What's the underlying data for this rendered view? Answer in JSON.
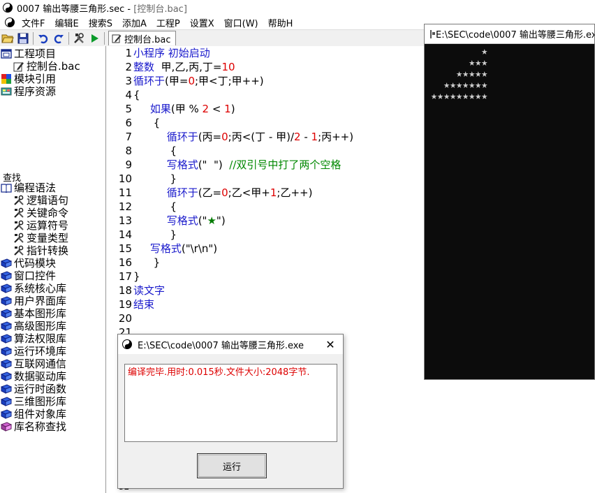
{
  "window": {
    "title_file": "0007 输出等腰三角形.sec",
    "title_sep": " - ",
    "title_doc": "[控制台.bac]"
  },
  "menu": [
    "文件F",
    "编辑E",
    "搜索S",
    "添加A",
    "工程P",
    "设置X",
    "窗口(W)",
    "帮助H"
  ],
  "toolbar": {
    "doc_tab": "控制台.bac"
  },
  "project_tree": [
    {
      "label": "工程项目",
      "icon": "project-window-icon",
      "level": 0
    },
    {
      "label": "控制台.bac",
      "icon": "edit-pencil-icon",
      "level": 1
    },
    {
      "label": "模块引用",
      "icon": "module-ref-icon",
      "level": 0
    },
    {
      "label": "程序资源",
      "icon": "resource-icon",
      "level": 0
    }
  ],
  "find": {
    "title": "查找",
    "items": [
      {
        "label": "编程语法",
        "icon": "open-book-icon",
        "level": 0
      },
      {
        "label": "逻辑语句",
        "icon": "tools-icon",
        "level": 1
      },
      {
        "label": "关键命令",
        "icon": "tools-icon",
        "level": 1
      },
      {
        "label": "运算符号",
        "icon": "tools-icon",
        "level": 1
      },
      {
        "label": "变量类型",
        "icon": "tools-icon",
        "level": 1
      },
      {
        "label": "指针转换",
        "icon": "tools-icon",
        "level": 1
      },
      {
        "label": "代码模块",
        "icon": "blue-book-icon",
        "level": 0
      },
      {
        "label": "窗口控件",
        "icon": "blue-book-icon",
        "level": 0
      },
      {
        "label": "系统核心库",
        "icon": "blue-book-icon",
        "level": 0
      },
      {
        "label": "用户界面库",
        "icon": "blue-book-icon",
        "level": 0
      },
      {
        "label": "基本图形库",
        "icon": "blue-book-icon",
        "level": 0
      },
      {
        "label": "高级图形库",
        "icon": "blue-book-icon",
        "level": 0
      },
      {
        "label": "算法权限库",
        "icon": "blue-book-icon",
        "level": 0
      },
      {
        "label": "运行环境库",
        "icon": "blue-book-icon",
        "level": 0
      },
      {
        "label": "互联网通信",
        "icon": "blue-book-icon",
        "level": 0
      },
      {
        "label": "数据驱动库",
        "icon": "blue-book-icon",
        "level": 0
      },
      {
        "label": "运行时函数",
        "icon": "blue-book-icon",
        "level": 0
      },
      {
        "label": "三维图形库",
        "icon": "blue-book-icon",
        "level": 0
      },
      {
        "label": "组件对象库",
        "icon": "blue-book-icon",
        "level": 0
      },
      {
        "label": "库名称查找",
        "icon": "purple-book-icon",
        "level": 0
      }
    ]
  },
  "editor": {
    "line_numbers": [
      "1",
      "2",
      "3",
      "4",
      "5",
      "6",
      "7",
      "8",
      "9",
      "10",
      "11",
      "12",
      "13",
      "14",
      "15",
      "16",
      "17",
      "18",
      "19",
      "20",
      "21"
    ],
    "lines": [
      [
        {
          "t": "小程序 初始启动",
          "c": "kw"
        }
      ],
      [
        {
          "t": "整数",
          "c": "kw"
        },
        {
          "t": "  甲,乙,丙,丁=",
          "c": ""
        },
        {
          "t": "10",
          "c": "num"
        }
      ],
      [
        {
          "t": "循环于",
          "c": "kw"
        },
        {
          "t": "(甲=",
          "c": ""
        },
        {
          "t": "0",
          "c": "num"
        },
        {
          "t": ";甲<丁;甲++)",
          "c": ""
        }
      ],
      [
        {
          "t": "{",
          "c": ""
        }
      ],
      [
        {
          "t": "     ",
          "c": ""
        },
        {
          "t": "如果",
          "c": "kw"
        },
        {
          "t": "(甲 % ",
          "c": ""
        },
        {
          "t": "2",
          "c": "num"
        },
        {
          "t": " < ",
          "c": ""
        },
        {
          "t": "1",
          "c": "num"
        },
        {
          "t": ")",
          "c": ""
        }
      ],
      [
        {
          "t": "      {",
          "c": ""
        }
      ],
      [
        {
          "t": "          ",
          "c": ""
        },
        {
          "t": "循环于",
          "c": "kw"
        },
        {
          "t": "(丙=",
          "c": ""
        },
        {
          "t": "0",
          "c": "num"
        },
        {
          "t": ";丙<(丁 - 甲)/",
          "c": ""
        },
        {
          "t": "2",
          "c": "num"
        },
        {
          "t": " - ",
          "c": ""
        },
        {
          "t": "1",
          "c": "num"
        },
        {
          "t": ";丙++)",
          "c": ""
        }
      ],
      [
        {
          "t": "           {",
          "c": ""
        }
      ],
      [
        {
          "t": "          ",
          "c": ""
        },
        {
          "t": "写格式",
          "c": "kw"
        },
        {
          "t": "(\"  \")  ",
          "c": ""
        },
        {
          "t": "//双引号中打了两个空格",
          "c": "cm"
        }
      ],
      [
        {
          "t": "           }",
          "c": ""
        }
      ],
      [
        {
          "t": "          ",
          "c": ""
        },
        {
          "t": "循环于",
          "c": "kw"
        },
        {
          "t": "(乙=",
          "c": ""
        },
        {
          "t": "0",
          "c": "num"
        },
        {
          "t": ";乙<甲+",
          "c": ""
        },
        {
          "t": "1",
          "c": "num"
        },
        {
          "t": ";乙++)",
          "c": ""
        }
      ],
      [
        {
          "t": "           {",
          "c": ""
        }
      ],
      [
        {
          "t": "          ",
          "c": ""
        },
        {
          "t": "写格式",
          "c": "kw"
        },
        {
          "t": "(\"",
          "c": ""
        },
        {
          "t": "★",
          "c": "gstar"
        },
        {
          "t": "\")",
          "c": ""
        }
      ],
      [
        {
          "t": "           }",
          "c": ""
        }
      ],
      [
        {
          "t": "     ",
          "c": ""
        },
        {
          "t": "写格式",
          "c": "kw"
        },
        {
          "t": "(\"\\r\\n\")",
          "c": ""
        }
      ],
      [
        {
          "t": "      }",
          "c": ""
        }
      ],
      [
        {
          "t": "}",
          "c": ""
        }
      ],
      [
        {
          "t": "读文字",
          "c": "kw"
        }
      ],
      [
        {
          "t": "结束",
          "c": "kw"
        }
      ],
      [
        {
          "t": "",
          "c": ""
        }
      ],
      [
        {
          "t": "",
          "c": ""
        }
      ]
    ]
  },
  "behind_line_number": "32",
  "console": {
    "title": "E:\\SEC\\code\\0007 输出等腰三角形.exe",
    "output": "         ★\n       ★★★\n     ★★★★★\n   ★★★★★★★\n ★★★★★★★★★"
  },
  "dialog": {
    "title": "E:\\SEC\\code\\0007 输出等腰三角形.exe",
    "close": "✕",
    "message": "编译完毕.用时:0.015秒.文件大小:2048字节.",
    "run_button": "运行"
  },
  "colors": {
    "keyword": "#1a1acc",
    "number": "#dd0000",
    "comment": "#008800",
    "console_bg": "#0c0c0c",
    "message": "#dd0000"
  }
}
